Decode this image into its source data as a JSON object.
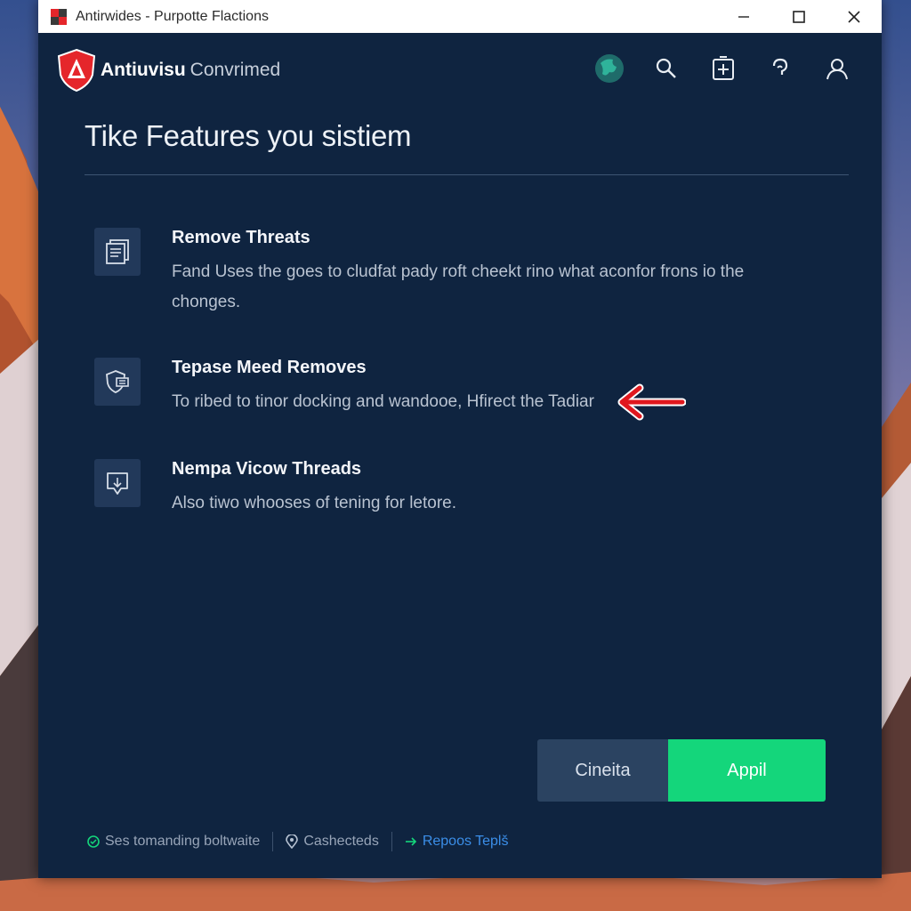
{
  "window": {
    "title": "Antirwides - Purpotte Flactions"
  },
  "app": {
    "brand_name": "Antiuvisu",
    "brand_sub": "Convrimed"
  },
  "header_icons": [
    "globe-icon",
    "search-icon",
    "add-icon",
    "help-icon",
    "user-icon"
  ],
  "page": {
    "title": "Tike Features you sistiem"
  },
  "features": [
    {
      "title": "Remove Threats",
      "description": "Fand Uses the goes to cludfat pady roft cheekt rino what aconfor frons io the chonges.",
      "icon": "document-icon"
    },
    {
      "title": "Tepase Meed Removes",
      "description": "To ribed to tinor docking and wandooe, Hfirect the Tadiar",
      "icon": "shield-icon"
    },
    {
      "title": "Nempa Vicow Threads",
      "description": "Also tiwo whooses of tening for letore.",
      "icon": "download-icon"
    }
  ],
  "buttons": {
    "cancel": "Cineita",
    "apply": "Appil"
  },
  "footer": {
    "status": "Ses tomanding boltwaite",
    "location": "Cashecteds",
    "link": "Repoos Teplš"
  },
  "colors": {
    "window_bg": "#0f2440",
    "accent_green": "#14d67b",
    "brand_red": "#e5262b",
    "link_blue": "#3b8ee8"
  }
}
